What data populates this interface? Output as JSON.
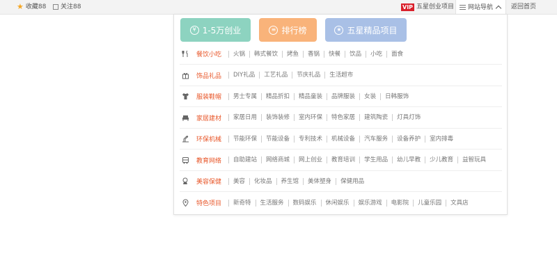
{
  "topbar": {
    "favorites": "收藏88",
    "follow": "关注88",
    "vip_badge": "VIP",
    "vip_text": "五星创业项目",
    "site_nav": "网站导航",
    "back_home": "返回首页"
  },
  "buttons": [
    {
      "label": "1-5万创业",
      "color": "#8dd3c0",
      "icon": "money-icon"
    },
    {
      "label": "排行榜",
      "color": "#f9b37a",
      "icon": "ranking-icon"
    },
    {
      "label": "五星精品项目",
      "color": "#a9c0e6",
      "icon": "star-icon"
    }
  ],
  "categories": [
    {
      "title": "餐饮小吃",
      "icon": "fork-knife-icon",
      "items": [
        "火锅",
        "韩式餐饮",
        "烤鱼",
        "香锅",
        "快餐",
        "饮品",
        "小吃",
        "面食"
      ]
    },
    {
      "title": "饰品礼品",
      "icon": "gift-icon",
      "items": [
        "DIY礼品",
        "工艺礼品",
        "节庆礼品",
        "生活超市"
      ]
    },
    {
      "title": "服装鞋帽",
      "icon": "shirt-icon",
      "items": [
        "男士专属",
        "精品折扣",
        "精品童装",
        "品牌服装",
        "女装",
        "日韩服饰"
      ]
    },
    {
      "title": "家居建材",
      "icon": "sofa-icon",
      "items": [
        "家居日用",
        "装饰装修",
        "室内环保",
        "特色家居",
        "建筑陶瓷",
        "灯具灯饰"
      ]
    },
    {
      "title": "环保机械",
      "icon": "machine-icon",
      "items": [
        "节能环保",
        "节能设备",
        "专利技术",
        "机械设备",
        "汽车服务",
        "设备养护",
        "室内排毒"
      ]
    },
    {
      "title": "教育网络",
      "icon": "bus-icon",
      "items": [
        "自助建站",
        "网络商城",
        "网上创业",
        "教育培训",
        "学生用品",
        "幼儿早教",
        "少儿教育",
        "益智玩具"
      ]
    },
    {
      "title": "美容保健",
      "icon": "beauty-icon",
      "items": [
        "美容",
        "化妆品",
        "养生馆",
        "美体塑身",
        "保健用品"
      ]
    },
    {
      "title": "特色项目",
      "icon": "location-icon",
      "items": [
        "新奇特",
        "生活服务",
        "数码娱乐",
        "休闲娱乐",
        "娱乐游戏",
        "电影院",
        "儿童乐园",
        "文具店"
      ]
    }
  ]
}
